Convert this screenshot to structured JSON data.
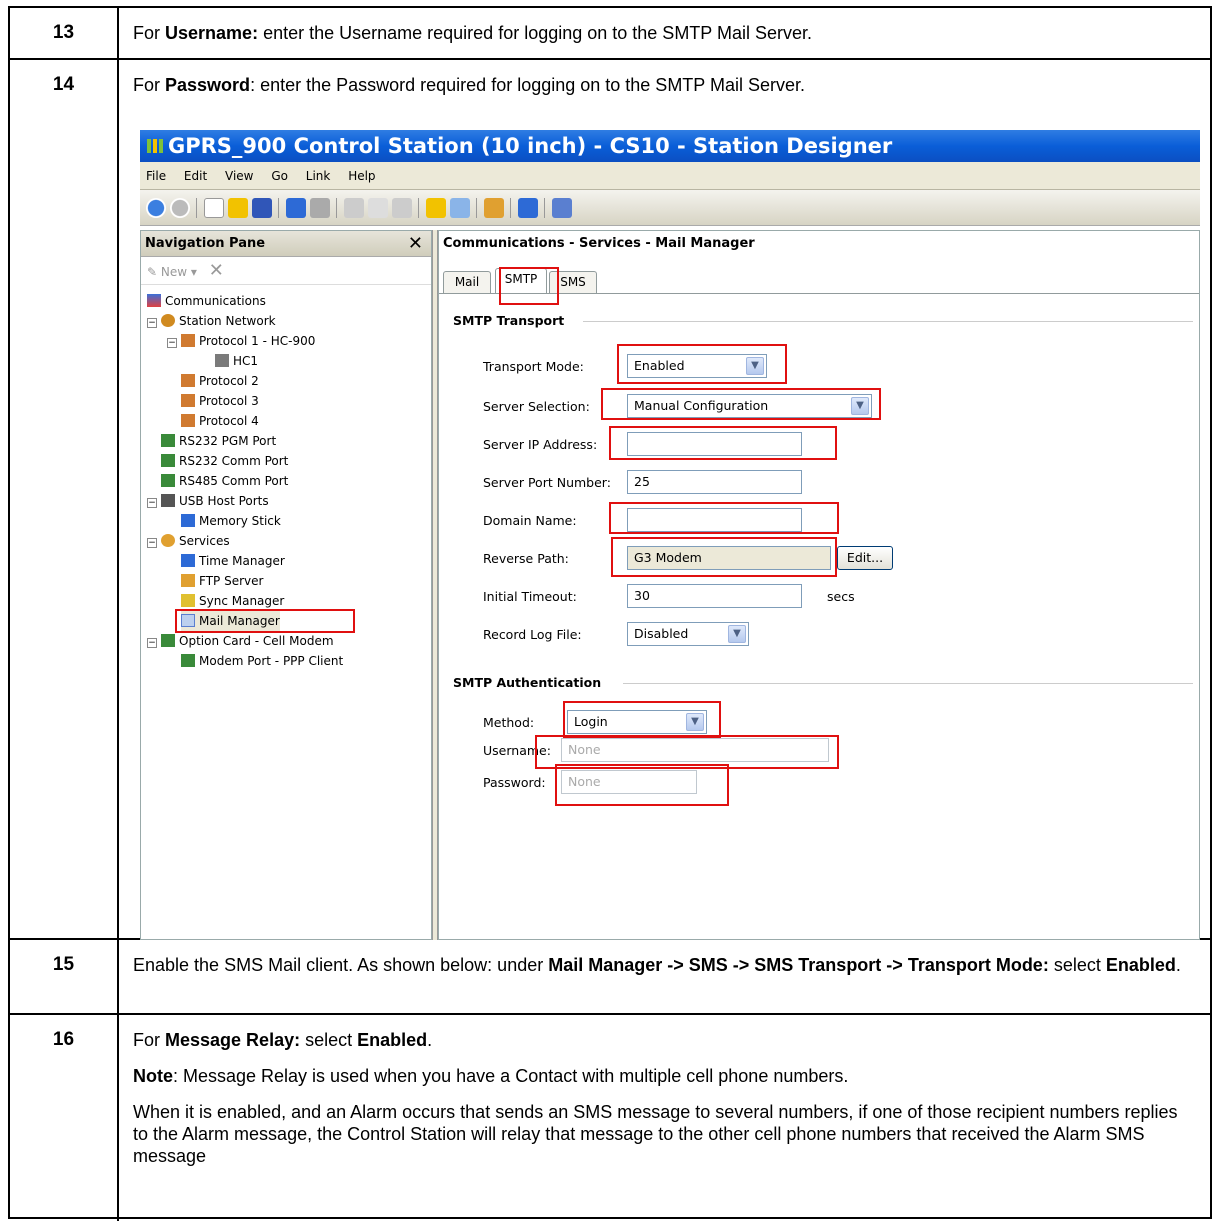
{
  "rows": [
    {
      "num": "13",
      "pre": "For ",
      "bold": "Username:",
      "post": " enter the Username required for logging on to the SMTP Mail Server."
    },
    {
      "num": "14",
      "pre": "For ",
      "bold": "Password",
      "post": ": enter the Password required for logging on to the SMTP Mail Server."
    },
    {
      "num": "15",
      "t1": "Enable the SMS Mail client. As shown below: under ",
      "b1": "Mail Manager -> SMS -> SMS Transport -> Transport Mode:",
      "t2": " select ",
      "b2": "Enabled",
      "t3": "."
    },
    {
      "num": "16",
      "t1": "For ",
      "b1": "Message Relay:",
      "t2": " select ",
      "b2": "Enabled",
      "t3": ".",
      "note_bold": "Note",
      "note_text": ": Message Relay is used when you have a Contact with multiple cell phone numbers.",
      "para": "When it is enabled, and an Alarm occurs that sends an SMS message to several numbers, if one of those recipient numbers replies to the Alarm message, the Control Station will relay that message to the other cell phone numbers that received the Alarm SMS message"
    }
  ],
  "app": {
    "title": "GPRS_900 Control Station (10 inch) - CS10 - Station Designer",
    "menu": [
      "File",
      "Edit",
      "View",
      "Go",
      "Link",
      "Help"
    ],
    "nav_title": "Navigation Pane",
    "nav_new": "New",
    "tree": [
      "Communications",
      "Station Network",
      "Protocol 1 - HC-900",
      "HC1",
      "Protocol 2",
      "Protocol 3",
      "Protocol 4",
      "RS232 PGM Port",
      "RS232 Comm Port",
      "RS485 Comm Port",
      "USB Host Ports",
      "Memory Stick",
      "Services",
      "Time Manager",
      "FTP Server",
      "Sync Manager",
      "Mail Manager",
      "Option Card - Cell Modem",
      "Modem Port - PPP Client"
    ],
    "content_title": "Communications - Services - Mail Manager",
    "tabs": [
      "Mail",
      "SMTP",
      "SMS"
    ],
    "smtp_transport": "SMTP Transport",
    "fields": {
      "transport_mode": {
        "label": "Transport Mode:",
        "value": "Enabled"
      },
      "server_selection": {
        "label": "Server Selection:",
        "value": "Manual Configuration"
      },
      "server_ip": {
        "label": "Server IP Address:",
        "value": ""
      },
      "server_port": {
        "label": "Server Port Number:",
        "value": "25"
      },
      "domain_name": {
        "label": "Domain Name:",
        "value": ""
      },
      "reverse_path": {
        "label": "Reverse Path:",
        "value": "G3 Modem",
        "button": "Edit..."
      },
      "initial_timeout": {
        "label": "Initial Timeout:",
        "value": "30",
        "unit": "secs"
      },
      "record_log": {
        "label": "Record Log File:",
        "value": "Disabled"
      }
    },
    "smtp_auth": "SMTP Authentication",
    "auth": {
      "method": {
        "label": "Method:",
        "value": "Login"
      },
      "username": {
        "label": "Username:",
        "placeholder": "None"
      },
      "password": {
        "label": "Password:",
        "placeholder": "None"
      }
    },
    "highlight_color": "#e01010"
  }
}
